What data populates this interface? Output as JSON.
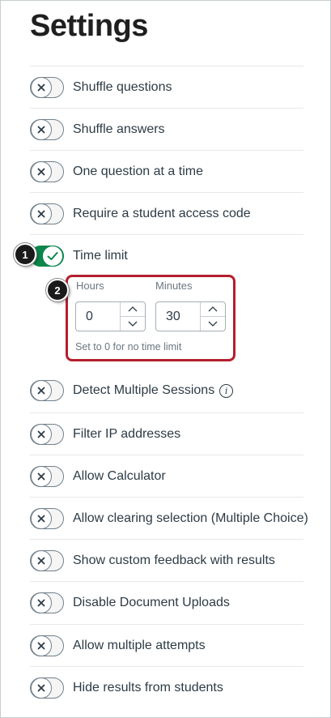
{
  "page": {
    "title": "Settings"
  },
  "settings": [
    {
      "label": "Shuffle questions",
      "enabled": false
    },
    {
      "label": "Shuffle answers",
      "enabled": false
    },
    {
      "label": "One question at a time",
      "enabled": false
    },
    {
      "label": "Require a student access code",
      "enabled": false
    },
    {
      "label": "Time limit",
      "enabled": true
    },
    {
      "label": "Detect Multiple Sessions",
      "enabled": false,
      "info_icon": "info-icon"
    },
    {
      "label": "Filter IP addresses",
      "enabled": false
    },
    {
      "label": "Allow Calculator",
      "enabled": false
    },
    {
      "label": "Allow clearing selection (Multiple Choice)",
      "enabled": false
    },
    {
      "label": "Show custom feedback with results",
      "enabled": false
    },
    {
      "label": "Disable Document Uploads",
      "enabled": false
    },
    {
      "label": "Allow multiple attempts",
      "enabled": false
    },
    {
      "label": "Hide results from students",
      "enabled": false
    }
  ],
  "time_limit": {
    "hours_label": "Hours",
    "hours_value": "0",
    "minutes_label": "Minutes",
    "minutes_value": "30",
    "hint": "Set to 0 for no time limit"
  },
  "callouts": {
    "first": "1",
    "second": "2"
  },
  "colors": {
    "toggle_on": "#0b874b",
    "callout_border": "#b41f2e",
    "text": "#2d3b45"
  }
}
